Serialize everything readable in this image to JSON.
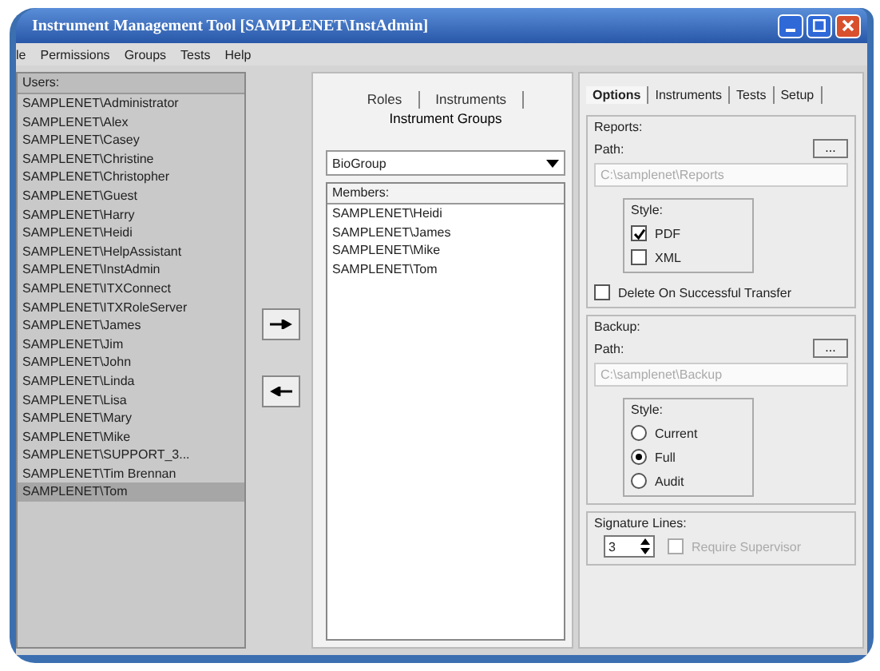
{
  "window": {
    "title": "Instrument Management Tool [SAMPLENET\\InstAdmin]"
  },
  "menu": [
    "le",
    "Permissions",
    "Groups",
    "Tests",
    "Help"
  ],
  "users": {
    "header": "Users:",
    "items": [
      {
        "label": "SAMPLENET\\Administrator",
        "selected": false
      },
      {
        "label": "SAMPLENET\\Alex",
        "selected": false
      },
      {
        "label": "SAMPLENET\\Casey",
        "selected": false
      },
      {
        "label": "SAMPLENET\\Christine",
        "selected": false
      },
      {
        "label": "SAMPLENET\\Christopher",
        "selected": false
      },
      {
        "label": "SAMPLENET\\Guest",
        "selected": false
      },
      {
        "label": "SAMPLENET\\Harry",
        "selected": false
      },
      {
        "label": "SAMPLENET\\Heidi",
        "selected": false
      },
      {
        "label": "SAMPLENET\\HelpAssistant",
        "selected": false
      },
      {
        "label": "SAMPLENET\\InstAdmin",
        "selected": false
      },
      {
        "label": "SAMPLENET\\ITXConnect",
        "selected": false
      },
      {
        "label": "SAMPLENET\\ITXRoleServer",
        "selected": false
      },
      {
        "label": "SAMPLENET\\James",
        "selected": false
      },
      {
        "label": "SAMPLENET\\Jim",
        "selected": false
      },
      {
        "label": "SAMPLENET\\John",
        "selected": false
      },
      {
        "label": "SAMPLENET\\Linda",
        "selected": false
      },
      {
        "label": "SAMPLENET\\Lisa",
        "selected": false
      },
      {
        "label": "SAMPLENET\\Mary",
        "selected": false
      },
      {
        "label": "SAMPLENET\\Mike",
        "selected": false
      },
      {
        "label": "SAMPLENET\\SUPPORT_3...",
        "selected": false
      },
      {
        "label": "SAMPLENET\\Tim Brennan",
        "selected": false
      },
      {
        "label": "SAMPLENET\\Tom",
        "selected": true
      }
    ]
  },
  "middle": {
    "tabs": [
      {
        "label": "Roles",
        "selected": false
      },
      {
        "label": "Instruments",
        "selected": false
      },
      {
        "label": "Instrument Groups",
        "selected": true
      }
    ],
    "group": {
      "value": "BioGroup"
    },
    "members": {
      "header": "Members:",
      "items": [
        "SAMPLENET\\Heidi",
        "SAMPLENET\\James",
        "SAMPLENET\\Mike",
        "SAMPLENET\\Tom"
      ]
    }
  },
  "right": {
    "tabs": [
      {
        "label": "Options",
        "selected": true
      },
      {
        "label": "Instruments",
        "selected": false
      },
      {
        "label": "Tests",
        "selected": false
      },
      {
        "label": "Setup",
        "selected": false
      }
    ],
    "reports": {
      "title": "Reports:",
      "path_label": "Path:",
      "browse": "...",
      "path": "C:\\samplenet\\Reports",
      "style_label": "Style:",
      "options": [
        {
          "label": "PDF",
          "checked": true
        },
        {
          "label": "XML",
          "checked": false
        }
      ]
    },
    "delete_on_transfer": {
      "label": "Delete On Successful Transfer",
      "checked": false
    },
    "backup": {
      "title": "Backup:",
      "path_label": "Path:",
      "browse": "...",
      "path": "C:\\samplenet\\Backup",
      "style_label": "Style:",
      "options": [
        {
          "label": "Current",
          "selected": false
        },
        {
          "label": "Full",
          "selected": true
        },
        {
          "label": "Audit",
          "selected": false
        }
      ]
    },
    "signature": {
      "title": "Signature Lines:",
      "value": "3",
      "require": {
        "label": "Require Supervisor",
        "checked": false,
        "disabled": true
      }
    }
  }
}
